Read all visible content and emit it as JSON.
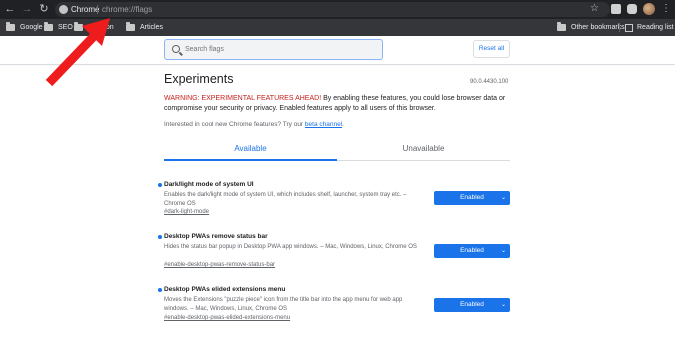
{
  "toolbar": {
    "back_icon": "back-arrow-icon",
    "forward_icon": "forward-arrow-icon",
    "reload_icon": "reload-icon",
    "omnibox_label": "Chrome",
    "omnibox_url": "chrome://flags"
  },
  "bookmarks": {
    "items": [
      {
        "label": "Google"
      },
      {
        "label": "SEO"
      },
      {
        "label": "Partition"
      },
      {
        "label": "Articles"
      }
    ],
    "other_label": "Other bookmarks",
    "reading_list_label": "Reading list"
  },
  "search": {
    "placeholder": "Search flags",
    "reset_label": "Reset all"
  },
  "page": {
    "title": "Experiments",
    "version": "90.0.4430.100",
    "warning_red": "WARNING: EXPERIMENTAL FEATURES AHEAD!",
    "warning_text": " By enabling these features, you could lose browser data or compromise your security or privacy. Enabled features apply to all users of this browser.",
    "cool_text": "Interested in cool new Chrome features? Try our ",
    "cool_link": "beta channel",
    "cool_end": "."
  },
  "tabs": {
    "available": "Available",
    "unavailable": "Unavailable"
  },
  "flags": [
    {
      "name": "Dark/light mode of system UI",
      "description": "Enables the dark/light mode of system UI, which includes shelf, launcher, system tray etc. – Chrome OS",
      "link": "#dark-light-mode",
      "value": "Enabled"
    },
    {
      "name": "Desktop PWAs remove status bar",
      "description": "Hides the status bar popup in Desktop PWA app windows. – Mac, Windows, Linux, Chrome OS",
      "link": "#enable-desktop-pwas-remove-status-bar",
      "value": "Enabled"
    },
    {
      "name": "Desktop PWAs elided extensions menu",
      "description": "Moves the Extensions \"puzzle piece\" icon from the title bar into the app menu for web app windows. – Mac, Windows, Linux, Chrome OS",
      "link": "#enable-desktop-pwas-elided-extensions-menu",
      "value": "Enabled"
    }
  ],
  "colors": {
    "accent": "#1a73e8",
    "warning": "#c5221f",
    "annotation_arrow": "#ee1c1c"
  }
}
